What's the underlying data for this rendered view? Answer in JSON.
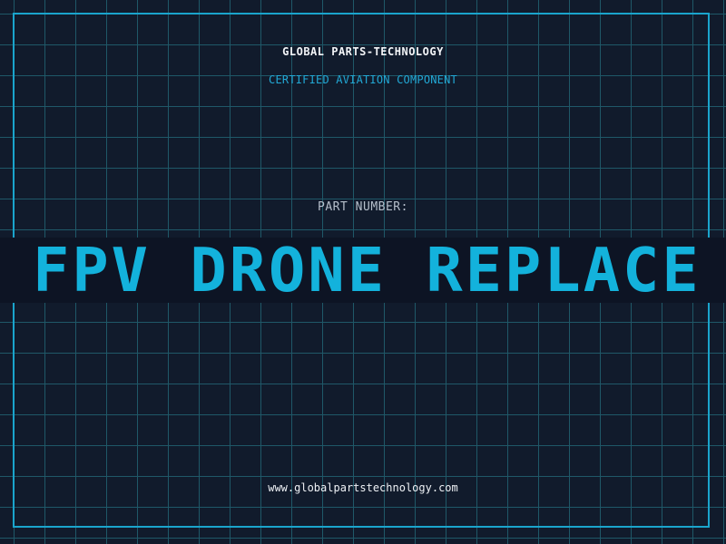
{
  "header": {
    "brand": "GLOBAL PARTS-TECHNOLOGY",
    "tagline": "CERTIFIED AVIATION COMPONENT"
  },
  "part": {
    "label": "PART NUMBER:",
    "value": "FPV DRONE REPLACE"
  },
  "footer": {
    "url": "www.globalpartstechnology.com"
  },
  "colors": {
    "background": "#111b2c",
    "grid": "#1f5868",
    "accent": "#13b2dc",
    "banner": "#0d1424"
  }
}
